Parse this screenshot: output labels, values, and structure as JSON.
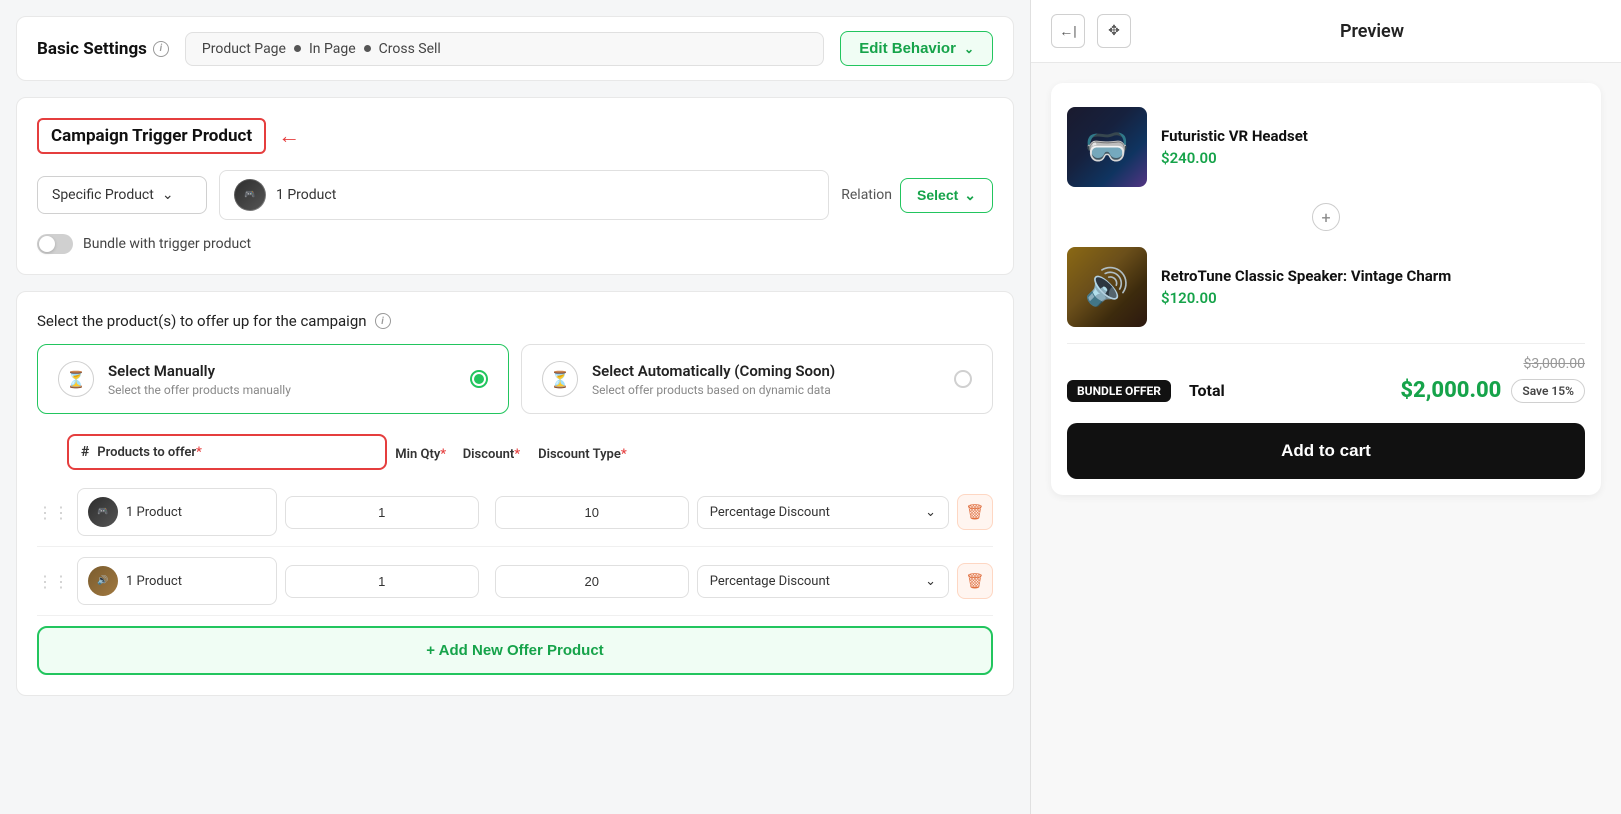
{
  "header": {
    "basic_settings": "Basic Settings",
    "breadcrumb": {
      "page": "Product Page",
      "placement": "In Page",
      "type": "Cross Sell"
    },
    "edit_behavior_btn": "Edit Behavior"
  },
  "campaign_trigger": {
    "title": "Campaign Trigger Product",
    "product_type_dropdown": "Specific Product",
    "product_count": "1 Product",
    "relation_label": "Relation",
    "relation_select": "Select",
    "bundle_label": "Bundle with trigger product"
  },
  "offer_section": {
    "title": "Select the product(s) to offer up for the campaign",
    "manual_card": {
      "title": "Select Manually",
      "subtitle": "Select the offer products manually"
    },
    "auto_card": {
      "title": "Select Automatically (Coming Soon)",
      "subtitle": "Select offer products based on dynamic data"
    }
  },
  "products_table": {
    "col_hash": "#",
    "col_product": "Products to offer",
    "col_product_required": "*",
    "col_minqty": "Min Qty",
    "col_minqty_required": "*",
    "col_discount": "Discount",
    "col_discount_required": "*",
    "col_disctype": "Discount Type",
    "col_disctype_required": "*",
    "rows": [
      {
        "product": "1 Product",
        "min_qty": "1",
        "discount": "10",
        "discount_type": "Percentage Discount"
      },
      {
        "product": "1 Product",
        "min_qty": "1",
        "discount": "20",
        "discount_type": "Percentage Discount"
      }
    ]
  },
  "add_product_btn": "+ Add New Offer Product",
  "preview": {
    "title": "Preview",
    "products": [
      {
        "name": "Futuristic VR Headset",
        "price": "$240.00",
        "type": "vr"
      },
      {
        "name": "RetroTune Classic Speaker: Vintage Charm",
        "price": "$120.00",
        "type": "speaker"
      }
    ],
    "bundle_badge": "BUNDLE OFFER",
    "total_label": "Total",
    "original_price": "$3,000.00",
    "total_price": "$2,000.00",
    "save_label": "Save 15%",
    "add_to_cart": "Add to cart"
  }
}
